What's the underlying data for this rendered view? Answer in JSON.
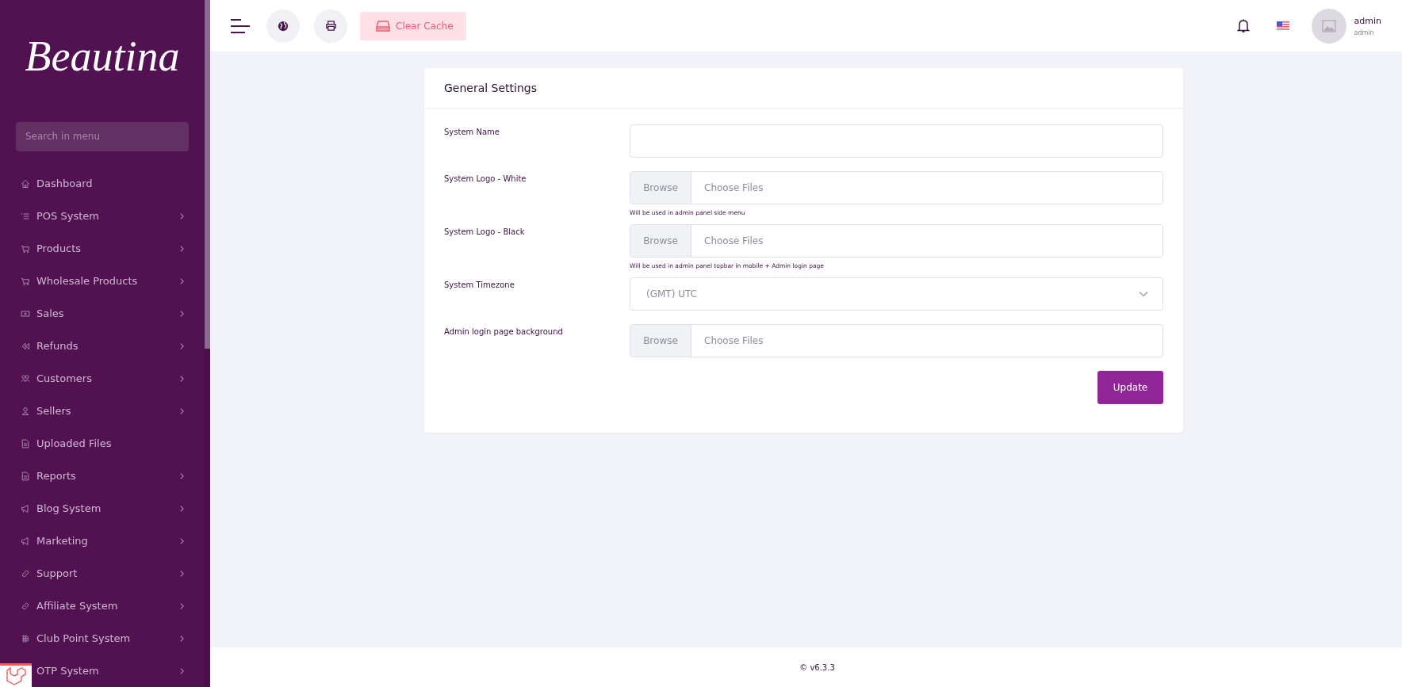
{
  "sidebar": {
    "logo": "Beautina",
    "search": {
      "placeholder": "Search in menu"
    },
    "items": [
      {
        "label": "Dashboard",
        "has_submenu": false
      },
      {
        "label": "POS System",
        "has_submenu": true
      },
      {
        "label": "Products",
        "has_submenu": true
      },
      {
        "label": "Wholesale Products",
        "has_submenu": true
      },
      {
        "label": "Sales",
        "has_submenu": true
      },
      {
        "label": "Refunds",
        "has_submenu": true
      },
      {
        "label": "Customers",
        "has_submenu": true
      },
      {
        "label": "Sellers",
        "has_submenu": true
      },
      {
        "label": "Uploaded Files",
        "has_submenu": false
      },
      {
        "label": "Reports",
        "has_submenu": true
      },
      {
        "label": "Blog System",
        "has_submenu": true
      },
      {
        "label": "Marketing",
        "has_submenu": true
      },
      {
        "label": "Support",
        "has_submenu": true
      },
      {
        "label": "Affiliate System",
        "has_submenu": true
      },
      {
        "label": "Club Point System",
        "has_submenu": true
      },
      {
        "label": "OTP System",
        "has_submenu": true
      }
    ]
  },
  "topbar": {
    "clear_cache": "Clear Cache",
    "user": {
      "name": "admin",
      "role": "admin"
    }
  },
  "card": {
    "title": "General Settings",
    "fields": [
      {
        "kind": "text",
        "label": "System Name"
      },
      {
        "kind": "file",
        "label": "System Logo - White",
        "browse": "Browse",
        "placeholder": "Choose Files",
        "hint": "Will be used in admin panel side menu"
      },
      {
        "kind": "file",
        "label": "System Logo - Black",
        "browse": "Browse",
        "placeholder": "Choose Files",
        "hint": "Will be used in admin panel topbar in mobile + Admin login page"
      },
      {
        "kind": "select",
        "label": "System Timezone",
        "value": "(GMT) UTC"
      },
      {
        "kind": "file",
        "label": "Admin login page background",
        "browse": "Browse",
        "placeholder": "Choose Files"
      }
    ],
    "submit": "Update"
  },
  "footer": {
    "version": "© v6.3.3"
  }
}
